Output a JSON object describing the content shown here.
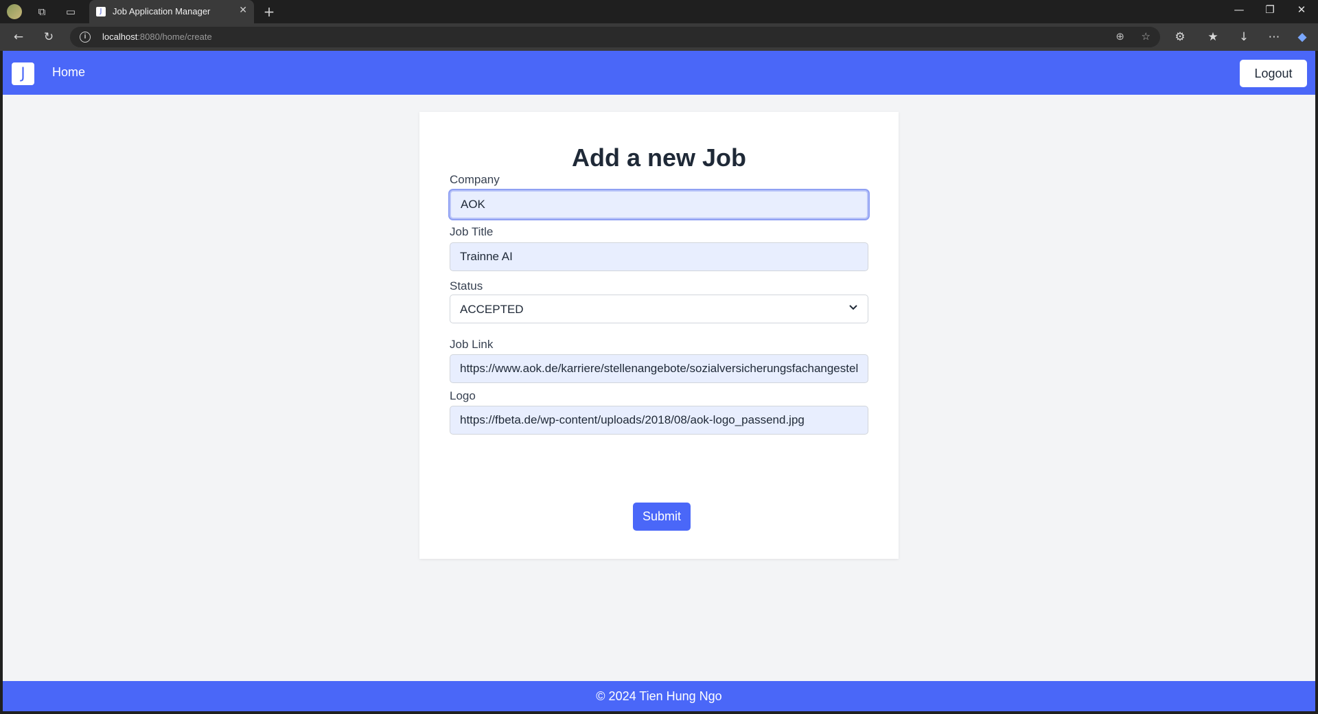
{
  "browser": {
    "tab_title": "Job Application Manager",
    "favicon_letter": "J",
    "url_host": "localhost",
    "url_rest": ":8080/home/create"
  },
  "navbar": {
    "brand_letter": "J",
    "home_label": "Home",
    "logout_label": "Logout",
    "accent_color": "#4a67f8"
  },
  "form": {
    "title": "Add a new Job",
    "company": {
      "label": "Company",
      "value": "AOK"
    },
    "job_title": {
      "label": "Job Title",
      "value": "Trainne AI"
    },
    "status": {
      "label": "Status",
      "value": "ACCEPTED"
    },
    "job_link": {
      "label": "Job Link",
      "value": "https://www.aok.de/karriere/stellenangebote/sozialversicherungsfachangestellte"
    },
    "logo": {
      "label": "Logo",
      "value": "https://fbeta.de/wp-content/uploads/2018/08/aok-logo_passend.jpg"
    },
    "submit_label": "Submit"
  },
  "footer": {
    "text": "© 2024 Tien Hung Ngo"
  }
}
